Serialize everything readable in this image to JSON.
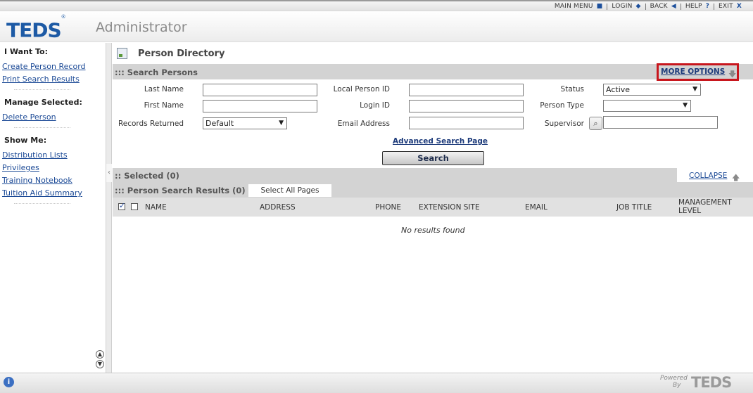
{
  "topnav": {
    "main_menu": "MAIN MENU",
    "login": "LOGIN",
    "back": "BACK",
    "help": "HELP",
    "exit": "EXIT"
  },
  "header": {
    "logo": "TEDS",
    "trademark": "®",
    "title": "Administrator"
  },
  "sidebar": {
    "i_want_to_heading": "I Want To:",
    "i_want_to": [
      "Create Person Record",
      "Print Search Results"
    ],
    "manage_heading": "Manage Selected:",
    "manage": [
      "Delete Person"
    ],
    "show_me_heading": "Show Me:",
    "show_me": [
      "Distribution Lists",
      "Privileges",
      "Training Notebook",
      "Tuition Aid Summary"
    ]
  },
  "page": {
    "title": "Person Directory"
  },
  "search_panel": {
    "title": "::: Search Persons",
    "more_options": "MORE OPTIONS",
    "fields": {
      "last_name": "Last Name",
      "first_name": "First Name",
      "records_returned": "Records Returned",
      "records_returned_value": "Default",
      "local_person_id": "Local Person ID",
      "login_id": "Login ID",
      "email_address": "Email Address",
      "status": "Status",
      "status_value": "Active",
      "person_type": "Person Type",
      "person_type_value": "",
      "supervisor": "Supervisor"
    },
    "advanced_link": "Advanced Search Page",
    "search_button": "Search"
  },
  "selected_panel": {
    "title": ":: Selected (0)",
    "collapse": "COLLAPSE"
  },
  "results_panel": {
    "title": "::: Person Search Results (0)",
    "select_all": "Select All Pages",
    "columns": [
      "NAME",
      "ADDRESS",
      "PHONE",
      "EXTENSION SITE",
      "EMAIL",
      "JOB TITLE",
      "MANAGEMENT LEVEL"
    ],
    "empty_message": "No results found"
  },
  "footer": {
    "powered": "Powered",
    "by": "By",
    "logo": "TEDS"
  }
}
